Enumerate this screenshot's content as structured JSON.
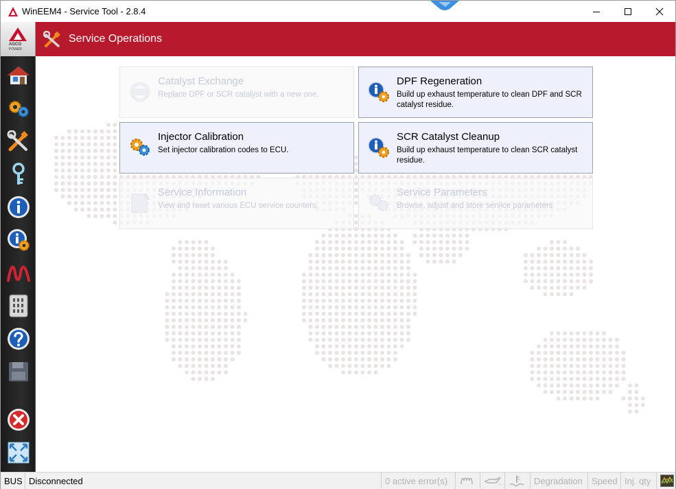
{
  "window": {
    "title": "WinEEM4 - Service Tool - 2.8.4",
    "controls": [
      "minimize",
      "maximize",
      "close"
    ]
  },
  "brand": {
    "logo_line1": "AGCO",
    "logo_line2": "POWER",
    "accent_color": "#b71a2c"
  },
  "header": {
    "title": "Service Operations",
    "icon": "tools-icon"
  },
  "sidebar": {
    "items": [
      {
        "name": "home",
        "icon": "home-icon"
      },
      {
        "name": "settings",
        "icon": "gears-icon"
      },
      {
        "name": "service",
        "icon": "tools-icon"
      },
      {
        "name": "key",
        "icon": "key-icon"
      },
      {
        "name": "info",
        "icon": "info-icon"
      },
      {
        "name": "info-settings",
        "icon": "info-gear-icon"
      },
      {
        "name": "signal",
        "icon": "waveform-icon"
      },
      {
        "name": "memory",
        "icon": "ecu-module-icon"
      },
      {
        "name": "help",
        "icon": "help-icon"
      },
      {
        "name": "save",
        "icon": "floppy-disk-icon"
      },
      {
        "name": "exit",
        "icon": "close-icon"
      },
      {
        "name": "fullscreen",
        "icon": "fullscreen-icon"
      }
    ]
  },
  "operations": [
    {
      "title": "Catalyst Exchange",
      "description": "Replace DPF or SCR catalyst with a new one.",
      "enabled": false,
      "icon": "catalyst-icon"
    },
    {
      "title": "DPF Regeneration",
      "description": "Build up exhaust temperature to clean DPF and SCR catalyst residue.",
      "enabled": true,
      "icon": "info-gear-icon"
    },
    {
      "title": "Injector Calibration",
      "description": "Set injector calibration codes to ECU.",
      "enabled": true,
      "icon": "gears-icon"
    },
    {
      "title": "SCR Catalyst Cleanup",
      "description": "Build up exhaust temperature to clean SCR catalyst residue.",
      "enabled": true,
      "icon": "info-gear-icon"
    },
    {
      "title": "Service Information",
      "description": "View and reset various ECU service counters.",
      "enabled": false,
      "icon": "notepad-icon"
    },
    {
      "title": "Service Parameters",
      "description": "Browse, adjust and store service parameters",
      "enabled": false,
      "icon": "gears-icon"
    }
  ],
  "statusbar": {
    "bus_label": "BUS",
    "connection": "Disconnected",
    "errors": "0 active error(s)",
    "degradation": "Degradation",
    "speed": "Speed",
    "inj_qty": "Inj. qty"
  }
}
